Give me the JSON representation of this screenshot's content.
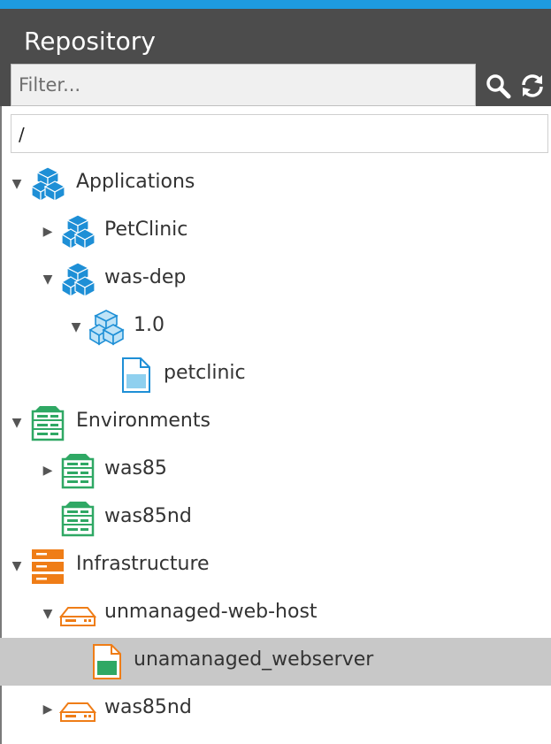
{
  "panel": {
    "title": "Repository",
    "filter_placeholder": "Filter...",
    "path": "/"
  },
  "icons": {
    "search": "search-icon",
    "refresh": "refresh-icon"
  },
  "colors": {
    "accent_strip": "#1e9be0",
    "header_bg": "#4c4c4c",
    "applications": "#1e8fd6",
    "environments": "#2fa864",
    "infrastructure": "#ef7d17",
    "selected_row": "#c8c8c8"
  },
  "tree": [
    {
      "label": "Applications",
      "expanded": true,
      "icon": "applications-icon"
    },
    {
      "label": "PetClinic",
      "expanded": false,
      "icon": "application-icon"
    },
    {
      "label": "was-dep",
      "expanded": true,
      "icon": "application-icon"
    },
    {
      "label": "1.0",
      "expanded": true,
      "icon": "version-icon"
    },
    {
      "label": "petclinic",
      "icon": "deployable-file-icon"
    },
    {
      "label": "Environments",
      "expanded": true,
      "icon": "environments-icon"
    },
    {
      "label": "was85",
      "expanded": false,
      "icon": "environment-icon"
    },
    {
      "label": "was85nd",
      "icon": "environment-icon"
    },
    {
      "label": "Infrastructure",
      "expanded": true,
      "icon": "infrastructure-icon"
    },
    {
      "label": "unmanaged-web-host",
      "expanded": true,
      "icon": "host-icon"
    },
    {
      "label": "unamanaged_webserver",
      "selected": true,
      "icon": "container-file-icon"
    },
    {
      "label": "was85nd",
      "expanded": false,
      "icon": "host-icon"
    }
  ]
}
